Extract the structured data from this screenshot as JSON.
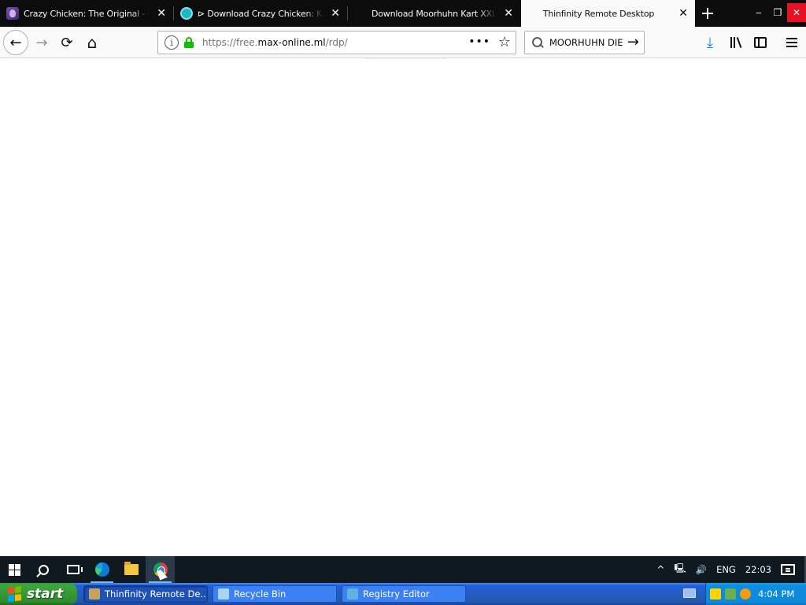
{
  "browser": {
    "tabs": [
      {
        "label": "Crazy Chicken: The Original - Old Games Download",
        "active": false,
        "close": "✕"
      },
      {
        "label": "⊳ Download Crazy Chicken: Kart",
        "active": false,
        "close": "✕"
      },
      {
        "label": "Download Moorhuhn Kart XXL (Windows)",
        "active": false,
        "close": "✕"
      },
      {
        "label": "Thinfinity Remote Desktop",
        "active": true,
        "close": "✕"
      }
    ],
    "new_tab": "+",
    "window_controls": {
      "minimize": "‒",
      "restore": "❐",
      "close": "✕"
    },
    "nav": {
      "back": "←",
      "forward": "→",
      "reload": "⟳",
      "home": "⌂"
    },
    "url": {
      "prefix": "https://free.",
      "host": "max-online.ml",
      "path": "/rdp/",
      "more": "•••",
      "bookmark": "☆",
      "info": "i"
    },
    "search": {
      "value": "MOORHUHN DIE",
      "go": "→"
    },
    "toolbar": {
      "download": "⤓"
    }
  },
  "remote_taskbar": {
    "tray": {
      "chevron": "^",
      "network": "🖳",
      "volume": "🔊",
      "language": "ENG",
      "time": "22:03"
    }
  },
  "xp_taskbar": {
    "start_label": "start",
    "tasks": [
      {
        "label": "Thinfinity Remote De...",
        "active": true
      },
      {
        "label": "Recycle Bin",
        "active": false
      },
      {
        "label": "Registry Editor",
        "active": false
      }
    ],
    "clock": "4:04 PM"
  },
  "colors": {
    "accent": "#0a84ff",
    "lock_green": "#12bc00",
    "xp_blue": "#245edc",
    "xp_start_green": "#3aa63a"
  }
}
